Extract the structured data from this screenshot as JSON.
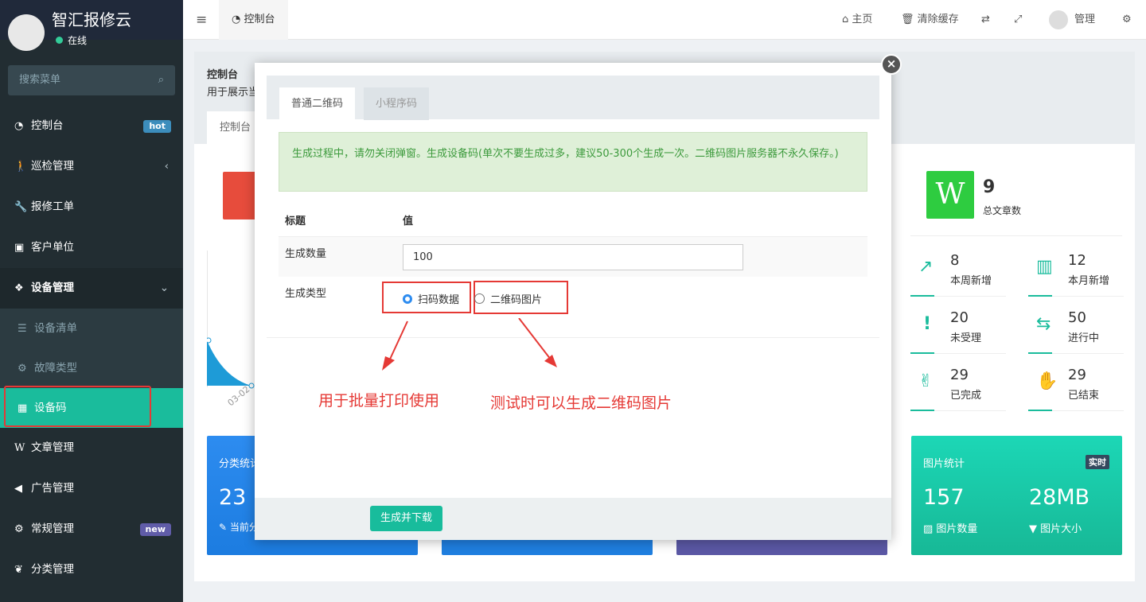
{
  "app": {
    "brand": "智汇报修云",
    "status": "在线",
    "search_placeholder": "搜索菜单"
  },
  "menu": {
    "items": [
      {
        "label": "控制台",
        "badge": "hot",
        "icon": "dashboard-icon"
      },
      {
        "label": "巡检管理",
        "icon": "walk-icon"
      },
      {
        "label": "报修工单",
        "icon": "wrench-icon"
      },
      {
        "label": "客户单位",
        "icon": "address-book-icon"
      },
      {
        "label": "设备管理",
        "icon": "cubes-icon"
      },
      {
        "label": "文章管理",
        "icon": "wordpress-icon"
      },
      {
        "label": "广告管理",
        "icon": "volume-icon"
      },
      {
        "label": "常规管理",
        "badge": "new",
        "icon": "cogs-icon"
      },
      {
        "label": "分类管理",
        "icon": "leaf-icon"
      }
    ],
    "sub": [
      {
        "label": "设备清单"
      },
      {
        "label": "故障类型"
      },
      {
        "label": "设备码"
      }
    ]
  },
  "header": {
    "tab": "控制台",
    "home": "主页",
    "clear_cache": "清除缓存",
    "user": "管理"
  },
  "content": {
    "title": "控制台",
    "desc": "用于展示当",
    "tab": "控制台",
    "x_tick": "03-02",
    "articles": {
      "value": "9",
      "label": "总文章数",
      "logo": "W"
    },
    "stats": [
      {
        "value": "8",
        "label": "本周新增"
      },
      {
        "value": "12",
        "label": "本月新增"
      },
      {
        "value": "20",
        "label": "未受理"
      },
      {
        "value": "50",
        "label": "进行中"
      },
      {
        "value": "29",
        "label": "已完成"
      },
      {
        "value": "29",
        "label": "已结束"
      }
    ],
    "card1": {
      "title": "分类统计",
      "value": "23",
      "sub": "当前分"
    },
    "pic": {
      "title": "图片统计",
      "badge": "实时",
      "count": "157",
      "count_label": "图片数量",
      "size": "28MB",
      "size_label": "图片大小"
    }
  },
  "modal": {
    "tabs": [
      "普通二维码",
      "小程序码"
    ],
    "alert": "生成过程中，请勿关闭弹窗。生成设备码(单次不要生成过多，建议50-300个生成一次。二维码图片服务器不永久保存。)",
    "col_title": "标题",
    "col_value": "值",
    "count_label": "生成数量",
    "count_value": "100",
    "type_label": "生成类型",
    "options": [
      "扫码数据",
      "二维码图片"
    ],
    "submit": "生成并下载"
  },
  "annotations": [
    "用于批量打印使用",
    "测试时可以生成二维码图片"
  ],
  "colors": {
    "accent": "#18bc9c",
    "annotation": "#e53935",
    "blue": "#2d8cf0"
  }
}
